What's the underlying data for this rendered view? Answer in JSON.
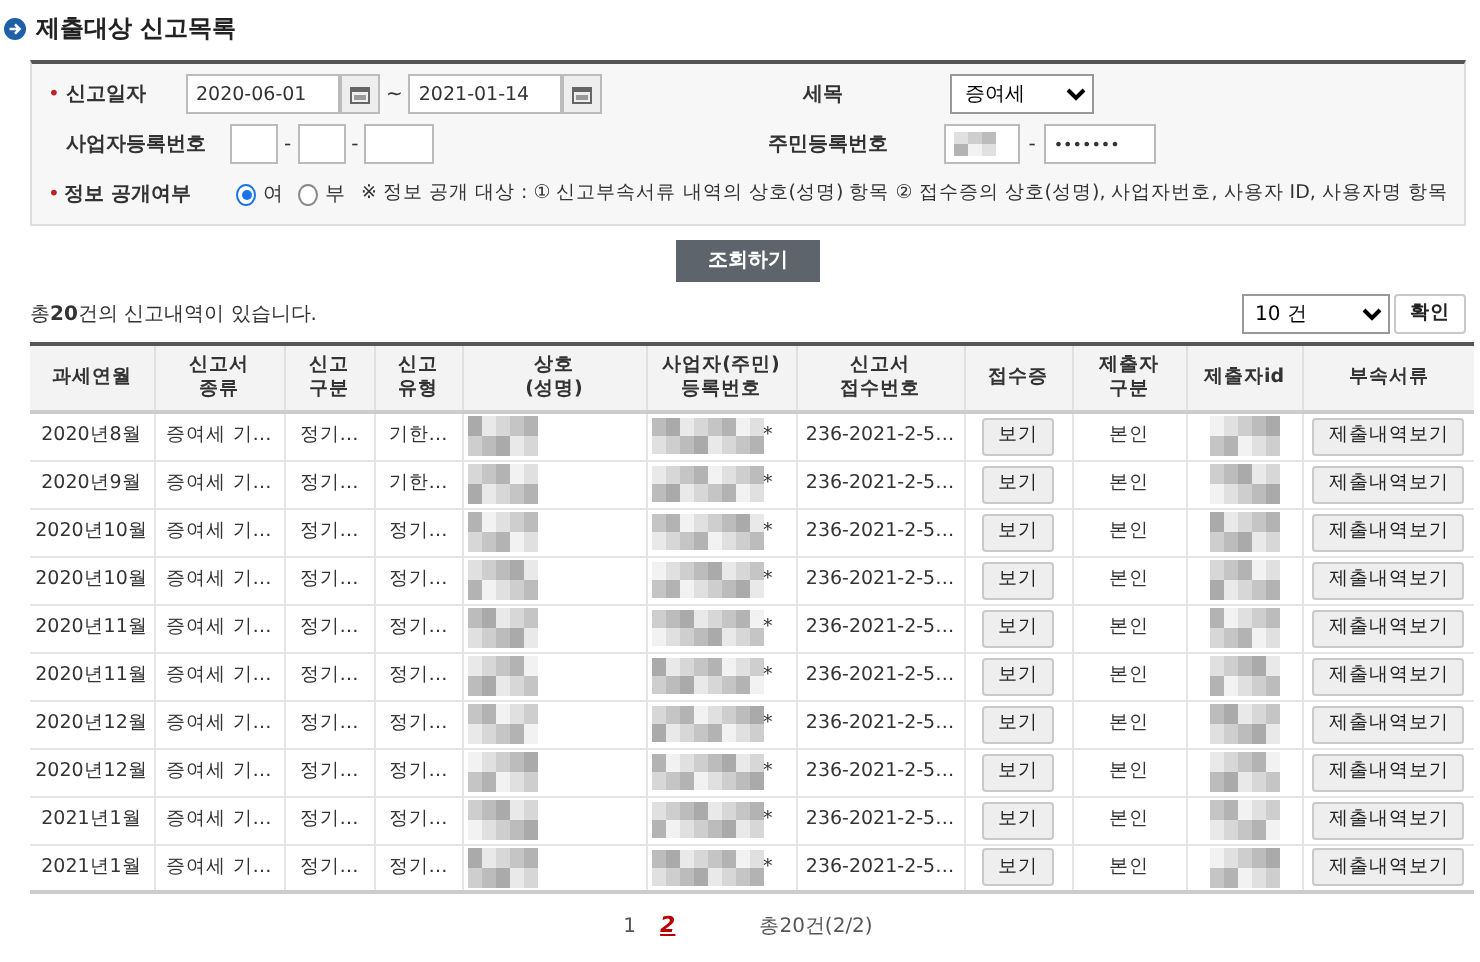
{
  "section_title": "제출대상 신고목록",
  "filters": {
    "required_mark": "•",
    "date_label": "신고일자",
    "date_from": "2020-06-01",
    "range_sep": "~",
    "date_to": "2021-01-14",
    "tax_label": "세목",
    "tax_value": "증여세",
    "bizno_label": "사업자등록번호",
    "bizno_sep": "-",
    "rrn_label": "주민등록번호",
    "rrn_sep": "-",
    "rrn_second": "•••••••"
  },
  "disclosure": {
    "required_mark": "•",
    "label": "정보 공개여부",
    "options": [
      {
        "label": "여",
        "selected": true
      },
      {
        "label": "부",
        "selected": false
      }
    ],
    "note": "※ 정보 공개 대상 : ① 신고부속서류 내역의 상호(성명) 항목 ② 접수증의 상호(성명), 사업자번호, 사용자 ID, 사용자명 항목"
  },
  "search_button": "조회하기",
  "summary": "총**20**건의 신고내역이 있습니다.",
  "page_size": "10 건",
  "confirm_button": "확인",
  "columns": [
    "과세연월",
    "신고서\n종류",
    "신고\n구분",
    "신고\n유형",
    "상호\n(성명)",
    "사업자(주민)\n등록번호",
    "신고서\n접수번호",
    "접수증",
    "제출자\n구분",
    "제출자id",
    "부속서류"
  ],
  "rows": [
    {
      "month": "2020년8월",
      "doc_type": "증여세 기…",
      "category": "정기…",
      "kind": "기한…",
      "bizno_suffix": "*",
      "receipt_no": "236-2021-2-5…",
      "receipt": "보기",
      "submitter": "본인",
      "attachments": "제출내역보기"
    },
    {
      "month": "2020년9월",
      "doc_type": "증여세 기…",
      "category": "정기…",
      "kind": "기한…",
      "bizno_suffix": "*",
      "receipt_no": "236-2021-2-5…",
      "receipt": "보기",
      "submitter": "본인",
      "attachments": "제출내역보기"
    },
    {
      "month": "2020년10월",
      "doc_type": "증여세 기…",
      "category": "정기…",
      "kind": "정기…",
      "bizno_suffix": "*",
      "receipt_no": "236-2021-2-5…",
      "receipt": "보기",
      "submitter": "본인",
      "attachments": "제출내역보기"
    },
    {
      "month": "2020년10월",
      "doc_type": "증여세 기…",
      "category": "정기…",
      "kind": "정기…",
      "bizno_suffix": "*",
      "receipt_no": "236-2021-2-5…",
      "receipt": "보기",
      "submitter": "본인",
      "attachments": "제출내역보기"
    },
    {
      "month": "2020년11월",
      "doc_type": "증여세 기…",
      "category": "정기…",
      "kind": "정기…",
      "bizno_suffix": "*",
      "receipt_no": "236-2021-2-5…",
      "receipt": "보기",
      "submitter": "본인",
      "attachments": "제출내역보기"
    },
    {
      "month": "2020년11월",
      "doc_type": "증여세 기…",
      "category": "정기…",
      "kind": "정기…",
      "bizno_suffix": "*",
      "receipt_no": "236-2021-2-5…",
      "receipt": "보기",
      "submitter": "본인",
      "attachments": "제출내역보기"
    },
    {
      "month": "2020년12월",
      "doc_type": "증여세 기…",
      "category": "정기…",
      "kind": "정기…",
      "bizno_suffix": "*",
      "receipt_no": "236-2021-2-5…",
      "receipt": "보기",
      "submitter": "본인",
      "attachments": "제출내역보기"
    },
    {
      "month": "2020년12월",
      "doc_type": "증여세 기…",
      "category": "정기…",
      "kind": "정기…",
      "bizno_suffix": "*",
      "receipt_no": "236-2021-2-5…",
      "receipt": "보기",
      "submitter": "본인",
      "attachments": "제출내역보기"
    },
    {
      "month": "2021년1월",
      "doc_type": "증여세 기…",
      "category": "정기…",
      "kind": "정기…",
      "bizno_suffix": "*",
      "receipt_no": "236-2021-2-5…",
      "receipt": "보기",
      "submitter": "본인",
      "attachments": "제출내역보기"
    },
    {
      "month": "2021년1월",
      "doc_type": "증여세 기…",
      "category": "정기…",
      "kind": "정기…",
      "bizno_suffix": "*",
      "receipt_no": "236-2021-2-5…",
      "receipt": "보기",
      "submitter": "본인",
      "attachments": "제출내역보기"
    }
  ],
  "pages": [
    {
      "label": "1",
      "selected": false
    },
    {
      "label": "2",
      "selected": true
    }
  ],
  "page_summary": "총20건(2/2)"
}
